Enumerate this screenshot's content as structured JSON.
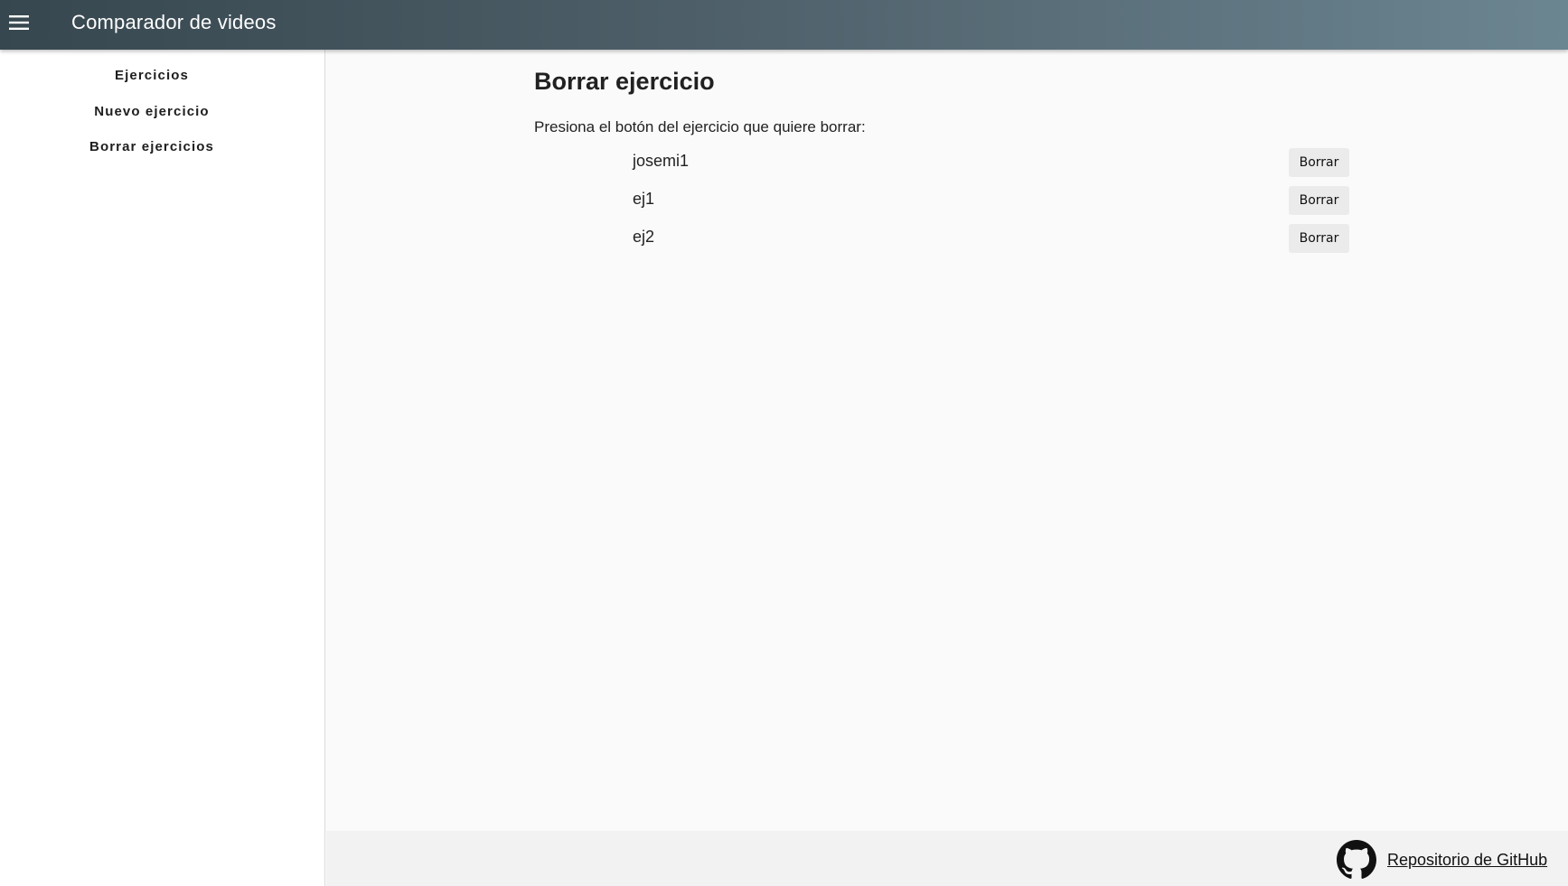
{
  "header": {
    "menu_icon": "hamburger-menu-icon",
    "title": "Comparador de videos"
  },
  "sidebar": {
    "items": [
      {
        "label": "Ejercicios"
      },
      {
        "label": "Nuevo ejercicio"
      },
      {
        "label": "Borrar ejercicios"
      }
    ]
  },
  "main": {
    "title": "Borrar ejercicio",
    "instructions": "Presiona el botón del ejercicio que quiere borrar:",
    "exercises": [
      {
        "name": "josemi1",
        "button_label": "Borrar"
      },
      {
        "name": "ej1",
        "button_label": "Borrar"
      },
      {
        "name": "ej2",
        "button_label": "Borrar"
      }
    ]
  },
  "footer": {
    "icon": "github-icon",
    "link_label": "Repositorio de GitHub"
  },
  "colors": {
    "header_start": "#37474f",
    "header_end": "#6b8591",
    "button_bg": "#ebebeb"
  }
}
